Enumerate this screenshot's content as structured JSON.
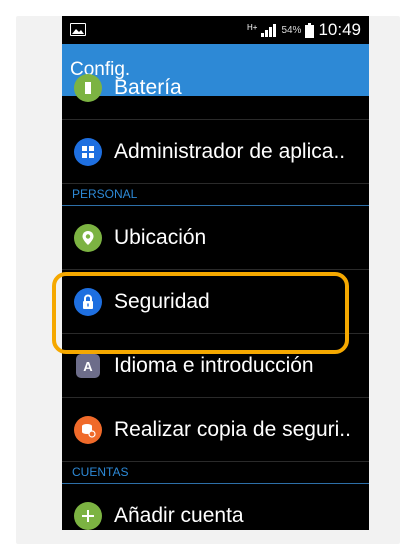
{
  "statusbar": {
    "battery": "54%",
    "time": "10:49",
    "network": "H+"
  },
  "appbar": {
    "title": "Config."
  },
  "items": [
    {
      "label": "Batería",
      "icon": "battery-icon",
      "color": "#7cb342"
    },
    {
      "label": "Administrador de aplica..",
      "icon": "apps-grid-icon",
      "color": "#1e6fe0"
    },
    {
      "label": "Ubicación",
      "icon": "location-pin-icon",
      "color": "#7cb342"
    },
    {
      "label": "Seguridad",
      "icon": "lock-icon",
      "color": "#1e6fe0"
    },
    {
      "label": "Idioma e introducción",
      "icon": "language-a-icon",
      "color": "#6d6d8a"
    },
    {
      "label": "Realizar copia de seguri..",
      "icon": "backup-icon",
      "color": "#f06a2a"
    },
    {
      "label": "Añadir cuenta",
      "icon": "add-icon",
      "color": "#7cb342"
    }
  ],
  "sections": {
    "personal": "PERSONAL",
    "cuentas": "CUENTAS"
  }
}
